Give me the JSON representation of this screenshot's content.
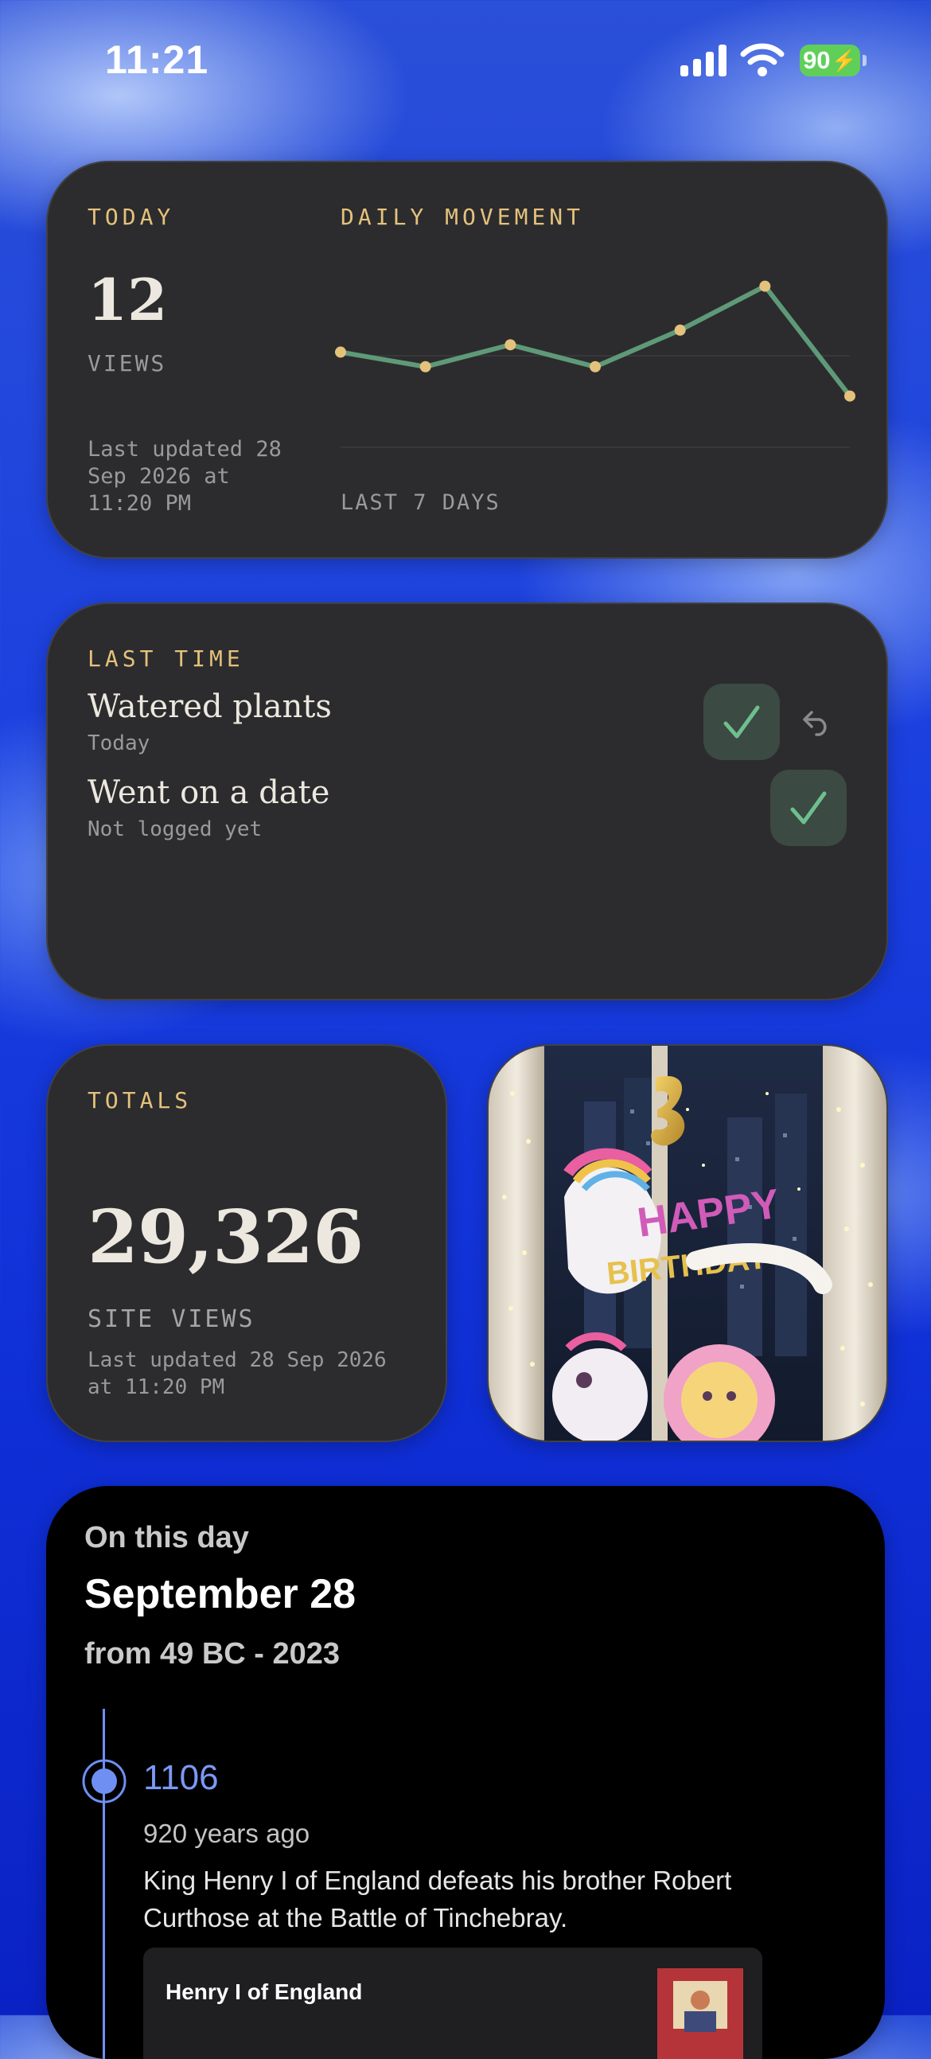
{
  "status_bar": {
    "time": "11:21",
    "battery": "90"
  },
  "views_widget": {
    "today_label": "TODAY",
    "views_count": "12",
    "views_label": "VIEWS",
    "updated": [
      "Last updated 28",
      "Sep 2026 at",
      "11:20 PM"
    ],
    "chart_title": "DAILY MOVEMENT",
    "chart_footer": "LAST 7 DAYS",
    "accent_color": "#e4c27b",
    "line_color": "#5f9a78"
  },
  "chart_data": {
    "type": "line",
    "title": "DAILY MOVEMENT",
    "xlabel": "LAST 7 DAYS",
    "ylabel": "",
    "x": [
      1,
      2,
      3,
      4,
      5,
      6,
      7
    ],
    "series": [
      {
        "values": [
          13,
          11,
          14,
          11,
          16,
          22,
          7
        ]
      }
    ],
    "ylim": [
      0,
      25
    ],
    "grid": true,
    "legend": "none"
  },
  "last_time_widget": {
    "title": "LAST TIME",
    "items": [
      {
        "label": "Watered plants",
        "sub": "Today",
        "has_undo": true
      },
      {
        "label": "Went on a date",
        "sub": "Not logged yet",
        "has_undo": false
      }
    ]
  },
  "totals_widget": {
    "title": "TOTALS",
    "count": "29,326",
    "label": "SITE VIEWS",
    "updated": [
      "Last updated 28 Sep 2026",
      "at 11:20 PM"
    ]
  },
  "photo_widget": {
    "icon": "birthday-photo"
  },
  "on_this_day": {
    "heading": "On this day",
    "date": "September 28",
    "range": "from 49 BC - 2023",
    "event": {
      "year": "1106",
      "ago": "920 years ago",
      "text_lines": [
        "King Henry I of England defeats his brother Robert",
        "Curthose at the Battle of Tinchebray."
      ],
      "card_title": "Henry I of England"
    },
    "accent_color": "#6f8ff3"
  }
}
